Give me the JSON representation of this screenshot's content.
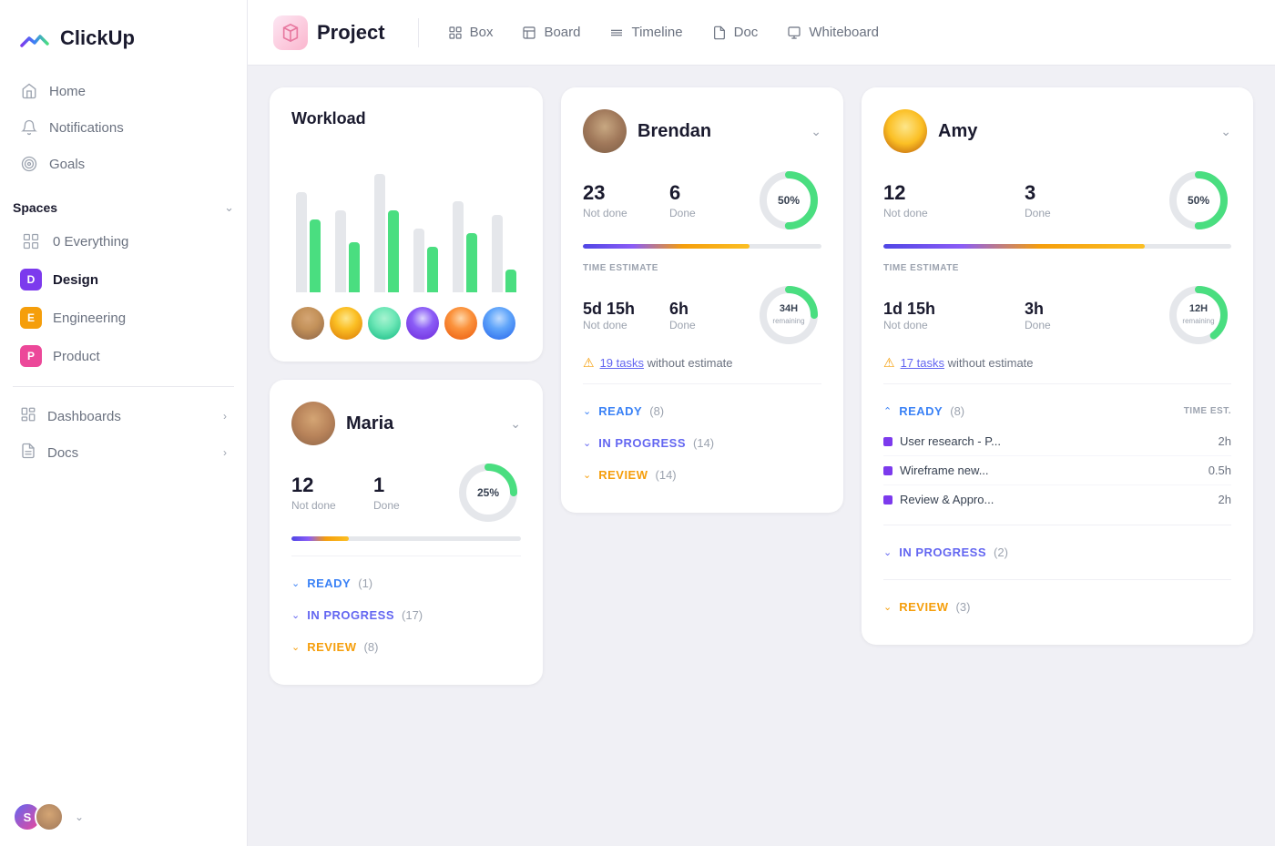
{
  "app": {
    "name": "ClickUp"
  },
  "sidebar": {
    "nav": [
      {
        "id": "home",
        "label": "Home",
        "icon": "home-icon"
      },
      {
        "id": "notifications",
        "label": "Notifications",
        "icon": "bell-icon"
      },
      {
        "id": "goals",
        "label": "Goals",
        "icon": "goals-icon"
      }
    ],
    "spaces": {
      "label": "Spaces",
      "items": [
        {
          "id": "everything",
          "label": "0 Everything",
          "badge": null,
          "badge_color": null
        },
        {
          "id": "design",
          "label": "Design",
          "badge": "D",
          "badge_color": "#7c3aed"
        },
        {
          "id": "engineering",
          "label": "Engineering",
          "badge": "E",
          "badge_color": "#f59e0b"
        },
        {
          "id": "product",
          "label": "Product",
          "badge": "P",
          "badge_color": "#ec4899"
        }
      ]
    },
    "bottom": [
      {
        "id": "dashboards",
        "label": "Dashboards",
        "has_chevron": true
      },
      {
        "id": "docs",
        "label": "Docs",
        "has_chevron": true
      }
    ]
  },
  "header": {
    "project_label": "Project",
    "nav": [
      {
        "id": "box",
        "label": "Box",
        "active": false
      },
      {
        "id": "board",
        "label": "Board",
        "active": false
      },
      {
        "id": "timeline",
        "label": "Timeline",
        "active": false
      },
      {
        "id": "doc",
        "label": "Doc",
        "active": false
      },
      {
        "id": "whiteboard",
        "label": "Whiteboard",
        "active": false
      }
    ]
  },
  "workload": {
    "title": "Workload",
    "bars": [
      {
        "gray_h": 110,
        "green_h": 80
      },
      {
        "gray_h": 90,
        "green_h": 55
      },
      {
        "gray_h": 130,
        "green_h": 90
      },
      {
        "gray_h": 70,
        "green_h": 50
      },
      {
        "gray_h": 100,
        "green_h": 65
      },
      {
        "gray_h": 85,
        "green_h": 25
      }
    ]
  },
  "brendan": {
    "name": "Brendan",
    "not_done": "23",
    "not_done_label": "Not done",
    "done": "6",
    "done_label": "Done",
    "percent": "50%",
    "percent_num": 50,
    "time_estimate_label": "TIME ESTIMATE",
    "time_not_done": "5d 15h",
    "time_not_done_label": "Not done",
    "time_done": "6h",
    "time_done_label": "Done",
    "remaining": "34H",
    "remaining_sub": "remaining",
    "warning_count": "19 tasks",
    "warning_text": " without estimate",
    "statuses": [
      {
        "id": "ready",
        "label": "READY",
        "count": "(8)",
        "color": "ready",
        "chevron_color": "blue"
      },
      {
        "id": "in_progress",
        "label": "IN PROGRESS",
        "count": "(14)",
        "color": "in-progress",
        "chevron_color": "indigo"
      },
      {
        "id": "review",
        "label": "REVIEW",
        "count": "(14)",
        "color": "review",
        "chevron_color": "yellow"
      }
    ]
  },
  "amy": {
    "name": "Amy",
    "not_done": "12",
    "not_done_label": "Not done",
    "done": "3",
    "done_label": "Done",
    "percent": "50%",
    "percent_num": 50,
    "time_estimate_label": "TIME ESTIMATE",
    "time_not_done": "1d 15h",
    "time_not_done_label": "Not done",
    "time_done": "3h",
    "time_done_label": "Done",
    "remaining": "12H",
    "remaining_sub": "remaining",
    "warning_count": "17 tasks",
    "warning_text": " without estimate",
    "time_est_col": "TIME EST.",
    "ready_label": "READY",
    "ready_count": "(8)",
    "tasks": [
      {
        "name": "User research - P...",
        "time": "2h"
      },
      {
        "name": "Wireframe new...",
        "time": "0.5h"
      },
      {
        "name": "Review & Appro...",
        "time": "2h"
      }
    ],
    "statuses": [
      {
        "id": "in_progress",
        "label": "IN PROGRESS",
        "count": "(2)",
        "color": "in-progress",
        "chevron_color": "indigo"
      },
      {
        "id": "review",
        "label": "REVIEW",
        "count": "(3)",
        "color": "review",
        "chevron_color": "yellow"
      }
    ]
  },
  "maria": {
    "name": "Maria",
    "not_done": "12",
    "not_done_label": "Not done",
    "done": "1",
    "done_label": "Done",
    "percent": "25%",
    "percent_num": 25,
    "statuses": [
      {
        "id": "ready",
        "label": "READY",
        "count": "(1)",
        "color": "ready",
        "chevron_color": "blue"
      },
      {
        "id": "in_progress",
        "label": "IN PROGRESS",
        "count": "(17)",
        "color": "in-progress",
        "chevron_color": "indigo"
      },
      {
        "id": "review",
        "label": "REVIEW",
        "count": "(8)",
        "color": "review",
        "chevron_color": "yellow"
      }
    ]
  }
}
